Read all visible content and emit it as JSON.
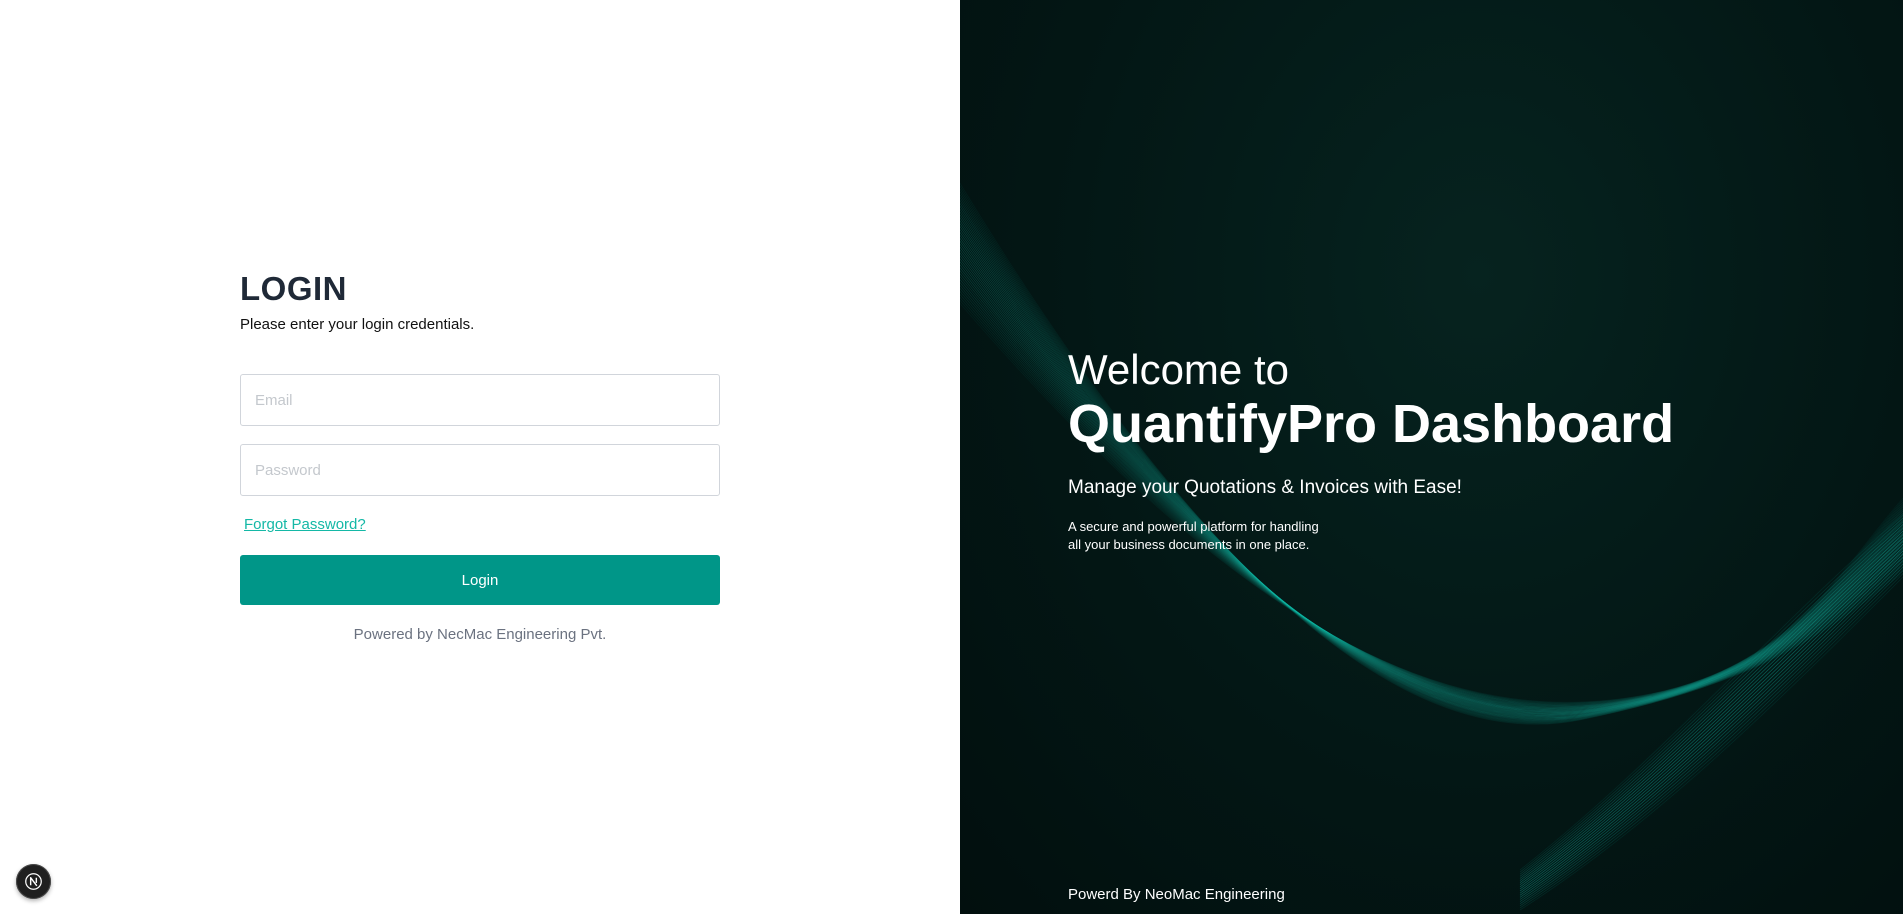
{
  "login": {
    "title": "LOGIN",
    "subtitle": "Please enter your login credentials.",
    "email_placeholder": "Email",
    "email_value": "",
    "password_placeholder": "Password",
    "password_value": "",
    "forgot_label": "Forgot Password?",
    "button_label": "Login",
    "powered_by": "Powered by NecMac Engineering Pvt."
  },
  "welcome": {
    "line1": "Welcome to",
    "line2": "QuantifyPro Dashboard",
    "tagline": "Manage your Quotations & Invoices with Ease!",
    "description": "A secure and powerful platform for handling\nall your business documents in one place.",
    "powered_by": "Powerd By NeoMac Engineering"
  },
  "badge": {
    "letter": "N",
    "icon": "nextjs-logo-icon"
  },
  "colors": {
    "accent": "#009688",
    "link": "#14b8a6",
    "dark_bg": "#031715",
    "wave": "#14b8a6"
  }
}
